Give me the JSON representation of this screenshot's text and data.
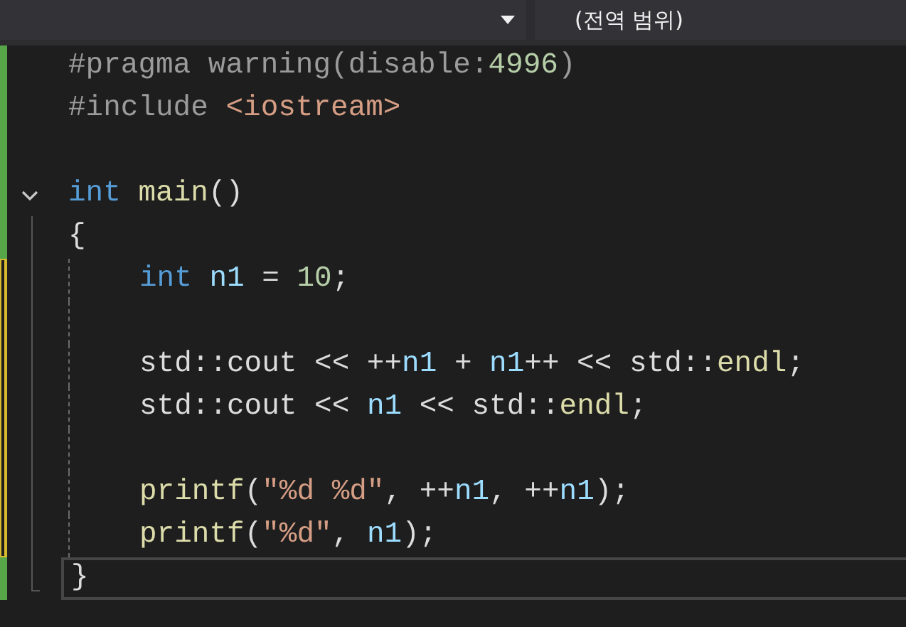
{
  "toolbar": {
    "scope_dropdown": {
      "value": "(전역 범위)"
    }
  },
  "lines": [
    {
      "kind": "saved",
      "tokens": [
        {
          "kind": "preproc",
          "text": "#pragma warning(disable:"
        },
        {
          "kind": "number",
          "text": "4996"
        },
        {
          "kind": "preproc",
          "text": ")"
        }
      ]
    },
    {
      "kind": "saved",
      "tokens": [
        {
          "kind": "preproc",
          "text": "#include "
        },
        {
          "kind": "string",
          "text": "<iostream>"
        }
      ]
    },
    {
      "kind": "saved"
    },
    {
      "kind": "saved",
      "expanded": true,
      "tokens": [
        {
          "kind": "keyword",
          "text": "int "
        },
        {
          "kind": "function",
          "text": "main"
        },
        {
          "kind": "plain",
          "text": "()"
        }
      ]
    },
    {
      "kind": "saved",
      "in_fold": true,
      "indent_guide": false,
      "tokens": [
        {
          "kind": "plain",
          "text": "{"
        }
      ]
    },
    {
      "kind": "unsaved",
      "in_fold": true,
      "indent_guide": true,
      "indented": true,
      "tokens": [
        {
          "kind": "keyword",
          "text": "int "
        },
        {
          "kind": "variable",
          "text": "n1"
        },
        {
          "kind": "plain",
          "text": " = "
        },
        {
          "kind": "number",
          "text": "10"
        },
        {
          "kind": "plain",
          "text": ";"
        }
      ]
    },
    {
      "kind": "unsaved",
      "in_fold": true,
      "indent_guide": true
    },
    {
      "kind": "unsaved",
      "in_fold": true,
      "indent_guide": true,
      "indented": true,
      "tokens": [
        {
          "kind": "plain",
          "text": "std::cout << ++"
        },
        {
          "kind": "variable",
          "text": "n1"
        },
        {
          "kind": "plain",
          "text": " + "
        },
        {
          "kind": "variable",
          "text": "n1"
        },
        {
          "kind": "plain",
          "text": "++ << std::"
        },
        {
          "kind": "function",
          "text": "endl"
        },
        {
          "kind": "plain",
          "text": ";"
        }
      ]
    },
    {
      "kind": "unsaved",
      "in_fold": true,
      "indent_guide": true,
      "indented": true,
      "tokens": [
        {
          "kind": "plain",
          "text": "std::cout << "
        },
        {
          "kind": "variable",
          "text": "n1"
        },
        {
          "kind": "plain",
          "text": " << std::"
        },
        {
          "kind": "function",
          "text": "endl"
        },
        {
          "kind": "plain",
          "text": ";"
        }
      ]
    },
    {
      "kind": "unsaved",
      "in_fold": true,
      "indent_guide": true
    },
    {
      "kind": "unsaved",
      "in_fold": true,
      "indent_guide": true,
      "indented": true,
      "tokens": [
        {
          "kind": "function",
          "text": "printf"
        },
        {
          "kind": "plain",
          "text": "("
        },
        {
          "kind": "string",
          "text": "\"%d %d\""
        },
        {
          "kind": "plain",
          "text": ", ++"
        },
        {
          "kind": "variable",
          "text": "n1"
        },
        {
          "kind": "plain",
          "text": ", ++"
        },
        {
          "kind": "variable",
          "text": "n1"
        },
        {
          "kind": "plain",
          "text": ");"
        }
      ]
    },
    {
      "kind": "unsaved",
      "in_fold": true,
      "indent_guide": true,
      "indented": true,
      "tokens": [
        {
          "kind": "function",
          "text": "printf"
        },
        {
          "kind": "plain",
          "text": "("
        },
        {
          "kind": "string",
          "text": "\"%d\""
        },
        {
          "kind": "plain",
          "text": ", "
        },
        {
          "kind": "variable",
          "text": "n1"
        },
        {
          "kind": "plain",
          "text": ");"
        }
      ]
    },
    {
      "kind": "saved",
      "fold_end": true,
      "current": true,
      "tokens": [
        {
          "kind": "plain",
          "text": "}"
        }
      ]
    }
  ]
}
